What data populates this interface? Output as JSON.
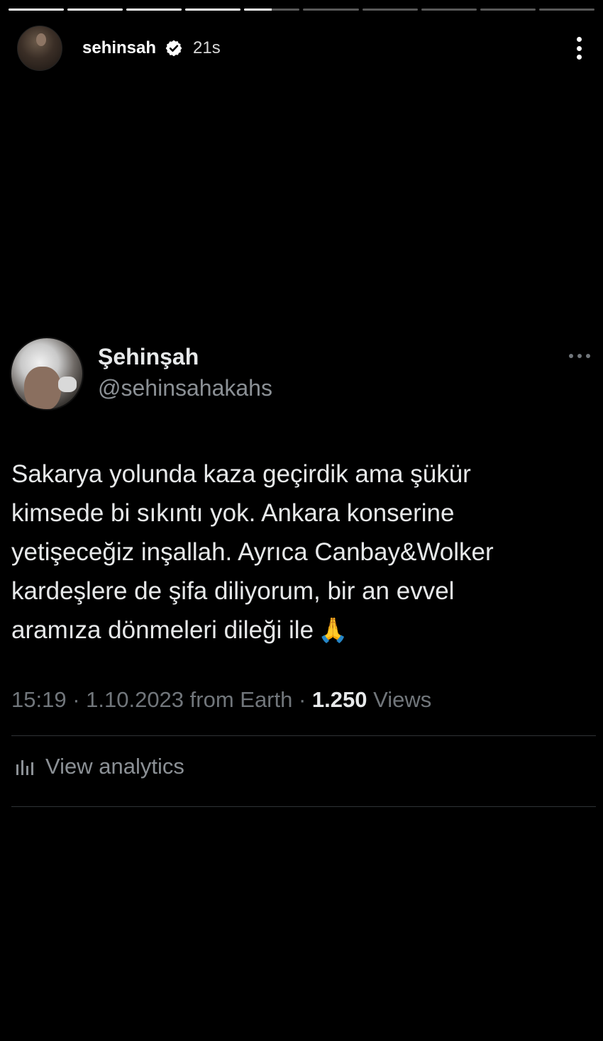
{
  "story": {
    "progress": [
      1,
      1,
      1,
      1,
      0.5,
      0,
      0,
      0,
      0,
      0
    ],
    "username": "sehinsah",
    "time": "21s"
  },
  "tweet": {
    "display_name": "Şehinşah",
    "handle": "@sehinsahakahs",
    "text": "Sakarya yolunda kaza geçirdik ama şükür\nkimsede bi sıkıntı yok. Ankara konserine\nyetişeceğiz inşallah. Ayrıca Canbay&Wolker\nkardeşlere de şifa diliyorum, bir an evvel\naramıza dönmeleri dileği ile",
    "emoji": "🙏",
    "meta_prefix": "15:19 · 1.10.2023 from Earth · ",
    "views_count": "1.250",
    "views_label": " Views",
    "analytics_label": "View analytics"
  },
  "colors": {
    "background": "#000000",
    "text_primary": "#e7e9ea",
    "text_secondary": "#71767b",
    "divider": "#2f3336"
  }
}
